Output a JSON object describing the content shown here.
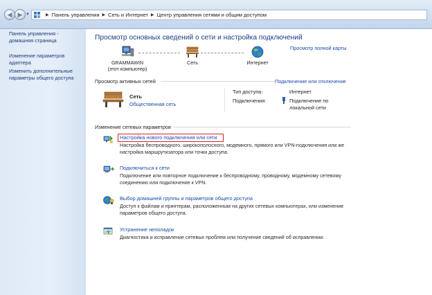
{
  "address_bar": {
    "crumbs": [
      "Панель управления",
      "Сеть и Интернет",
      "Центр управления сетями и общим доступом"
    ]
  },
  "sidebar": {
    "items": [
      {
        "lines": [
          "Панель управления -",
          "домашняя страница"
        ]
      },
      {
        "lines": [
          "Изменение параметров",
          "адаптера"
        ]
      },
      {
        "lines": [
          "Изменить дополнительные",
          "параметры общего доступа"
        ]
      }
    ]
  },
  "main": {
    "title": "Просмотр основных сведений о сети и настройка подключений",
    "full_map_link": "Просмотр полной карты",
    "network_map": {
      "computer_name": "GRAMMAWIN",
      "computer_sub": "(этот компьютер)",
      "network_label": "Сеть",
      "internet_label": "Интернет"
    },
    "active_networks": {
      "heading": "Просмотр активных сетей",
      "connect_link": "Подключение или отключение",
      "network_name": "Сеть",
      "network_type": "Общественная сеть",
      "access_type_label": "Тип доступа:",
      "access_type_value": "Интернет",
      "connections_label": "Подключения:",
      "connections_value_lines": [
        "Подключение по",
        "локальной сети"
      ]
    },
    "change_settings": {
      "heading": "Изменение сетевых параметров",
      "tasks": [
        {
          "title": "Настройка нового подключения или сети",
          "desc": "Настройка беспроводного, широкополосного, модемного, прямого или VPN-подключения или же настройка маршрутизатора или точки доступа."
        },
        {
          "title": "Подключиться к сети",
          "desc": "Подключение или повторное подключение к беспроводному, проводному, модемному сетевому соединению или подключение к VPN."
        },
        {
          "title": "Выбор домашней группы и параметров общего доступа",
          "desc": "Доступ к файлам и принтерам, расположенным на других сетевых компьютерах, или изменение параметров общего доступа."
        },
        {
          "title": "Устранение неполадок",
          "desc": "Диагностика и исправление сетевых проблем или получение сведений об исправлении."
        }
      ]
    }
  },
  "colors": {
    "link": "#1a4aa6",
    "title": "#1b3c82",
    "highlight": "#d8202a",
    "sidebar_bg": "#dfeaf6"
  },
  "icons": [
    "back-arrow-icon",
    "forward-arrow-icon",
    "control-panel-icon",
    "computer-icon",
    "bench-network-icon",
    "globe-icon",
    "network-adapter-icon",
    "new-connection-icon",
    "connect-network-icon",
    "homegroup-icon",
    "troubleshoot-icon"
  ]
}
